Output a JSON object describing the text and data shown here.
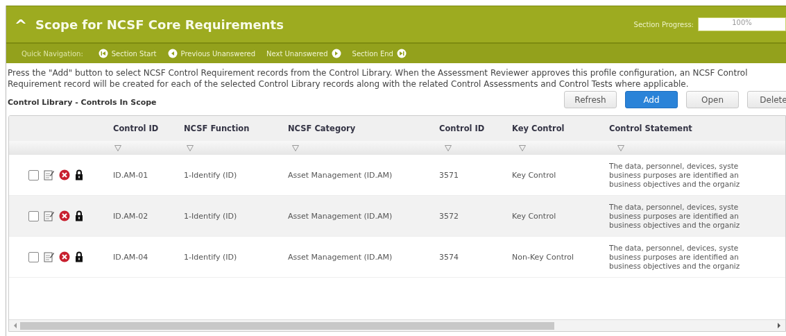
{
  "header": {
    "collapse_icon": "^",
    "title": "Scope for NCSF Core Requirements",
    "progress_label": "Section Progress:",
    "progress": {
      "level": 1.0,
      "reading": "100%"
    }
  },
  "quick_nav": {
    "label": "Quick Navigation:",
    "links": [
      {
        "text": "Section Start"
      },
      {
        "text": "Previous Unanswered"
      },
      {
        "text": "Next Unanswered"
      },
      {
        "text": "Section End"
      }
    ]
  },
  "description": "Press the \"Add\" button to select NCSF Control Requirement records from the Control Library. When the Assessment Reviewer approves this profile configuration, an NCSF Control Requirement record will be created for each of the selected Control Library records along with the related Control Assessments and Control Tests where applicable.",
  "grid_title": "Control Library - Controls In Scope",
  "buttons": [
    {
      "label": "Refresh",
      "primary": false
    },
    {
      "label": "Add",
      "primary": true
    },
    {
      "label": "Open",
      "primary": false
    },
    {
      "label": "Delete",
      "primary": false
    }
  ],
  "table": {
    "columns": [
      "Control ID",
      "NCSF Function",
      "NCSF Category",
      "Control ID",
      "Key Control",
      "Control Statement"
    ],
    "rows": [
      {
        "checked": false,
        "cells": [
          "ID.AM-01",
          "1-Identify (ID)",
          "Asset Management (ID.AM)",
          "3571",
          "Key Control"
        ],
        "statement": [
          "The data, personnel, devices, syste",
          "business purposes are identified an",
          "business objectives and the organiz"
        ]
      },
      {
        "checked": false,
        "cells": [
          "ID.AM-02",
          "1-Identify (ID)",
          "Asset Management (ID.AM)",
          "3572",
          "Key Control"
        ],
        "statement": [
          "The data, personnel, devices, syste",
          "business purposes are identified an",
          "business objectives and the organiz"
        ]
      },
      {
        "checked": false,
        "cells": [
          "ID.AM-04",
          "1-Identify (ID)",
          "Asset Management (ID.AM)",
          "3574",
          "Non-Key Control"
        ],
        "statement": [
          "The data, personnel, devices, syste",
          "business purposes are identified an",
          "business objectives and the organiz"
        ]
      }
    ]
  }
}
